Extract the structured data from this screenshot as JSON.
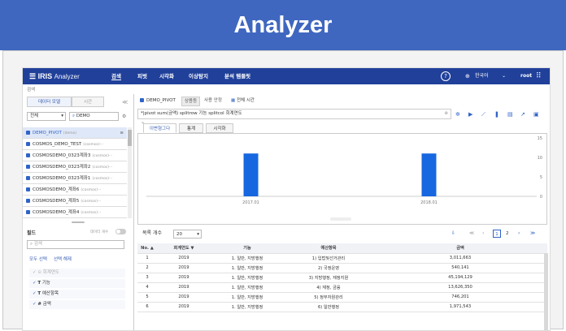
{
  "banner_title": "Analyzer",
  "app": {
    "logo_brand": "IRIS",
    "logo_product": "Analyzer"
  },
  "nav": [
    "검색",
    "피벗",
    "시각화",
    "이상탐지",
    "분석 템플릿"
  ],
  "top_right": {
    "help": "?",
    "language": "한국어",
    "user": "root"
  },
  "breadcrumb": "검색",
  "left_panel": {
    "tabs": [
      "데이터 모델",
      "시간"
    ],
    "collapse": "≪",
    "scope_select": "전체",
    "search_value": "DEMO",
    "models": [
      {
        "name": "DEMO_PIVOT",
        "sub": "(demo)"
      },
      {
        "name": "COSMOS_DEMO_TEST",
        "sub": "(cosmos)···"
      },
      {
        "name": "COSMOSDEMO_0323계좌3",
        "sub": "(cosmos)···"
      },
      {
        "name": "COSMOSDEMO_0323계좌2",
        "sub": "(cosmos)···"
      },
      {
        "name": "COSMOSDEMO_0323계좌1",
        "sub": "(cosmos)···"
      },
      {
        "name": "COSMOSDEMO_계좌6",
        "sub": "(cosmos)···"
      },
      {
        "name": "COSMOSDEMO_계좌5",
        "sub": "(cosmos)···"
      },
      {
        "name": "COSMOSDEMO_계좌4",
        "sub": "(cosmos)···"
      }
    ],
    "fields_title": "필드",
    "count_toggle_label": "데이터 개수",
    "field_search_placeholder": "검색",
    "select_all": "모두 선택",
    "deselect_all": "선택 해제",
    "fields": [
      {
        "type": "⊙",
        "name": "회계연도",
        "checked": false
      },
      {
        "type": "T",
        "name": "기능",
        "checked": true
      },
      {
        "type": "T",
        "name": "예산항목",
        "checked": true
      },
      {
        "type": "#",
        "name": "금액",
        "checked": true
      }
    ]
  },
  "main": {
    "model_tab": "DEMO_PIVOT",
    "toolbar_tabs": [
      "상용등",
      "사용 안정"
    ],
    "time_tab": "전체 시간",
    "query": "*|pivot sum(금액) splitrow 기능 splitcol 회계연도",
    "chart_tabs": [
      "이변형그다",
      "통계",
      "시각화"
    ],
    "y_ticks": [
      "15",
      "10",
      "5",
      "0"
    ],
    "x_ticks": [
      "2017.01",
      "2018.01"
    ],
    "rows_label": "목록 개수",
    "rows_value": "20",
    "pages": [
      "1",
      "2"
    ],
    "columns": [
      "No. ▲",
      "회계연도 ▼",
      "기능",
      "예산항목",
      "금액"
    ],
    "rows": [
      [
        "1",
        "2019",
        "1. 일반, 지방행정",
        "1) 입법및선거관리",
        "3,011,663"
      ],
      [
        "2",
        "2019",
        "1. 일반, 지방행정",
        "2) 국정운영",
        "540,141"
      ],
      [
        "3",
        "2019",
        "1. 일반, 지방행정",
        "3) 지방행정, 재정지원",
        "45,194,129"
      ],
      [
        "4",
        "2019",
        "1. 일반, 지방행정",
        "4) 재정, 금융",
        "13,626,350"
      ],
      [
        "5",
        "2019",
        "1. 일반, 지방행정",
        "5) 정부자원관리",
        "746,201"
      ],
      [
        "6",
        "2019",
        "1. 일반, 지방행정",
        "6) 일반행정",
        "1,971,543"
      ]
    ]
  },
  "chart_data": {
    "type": "bar",
    "categories": [
      "2017.01",
      "2018.01"
    ],
    "values": [
      11,
      11
    ],
    "ylim": [
      0,
      15
    ],
    "yticks": [
      15,
      10,
      5,
      0
    ]
  }
}
